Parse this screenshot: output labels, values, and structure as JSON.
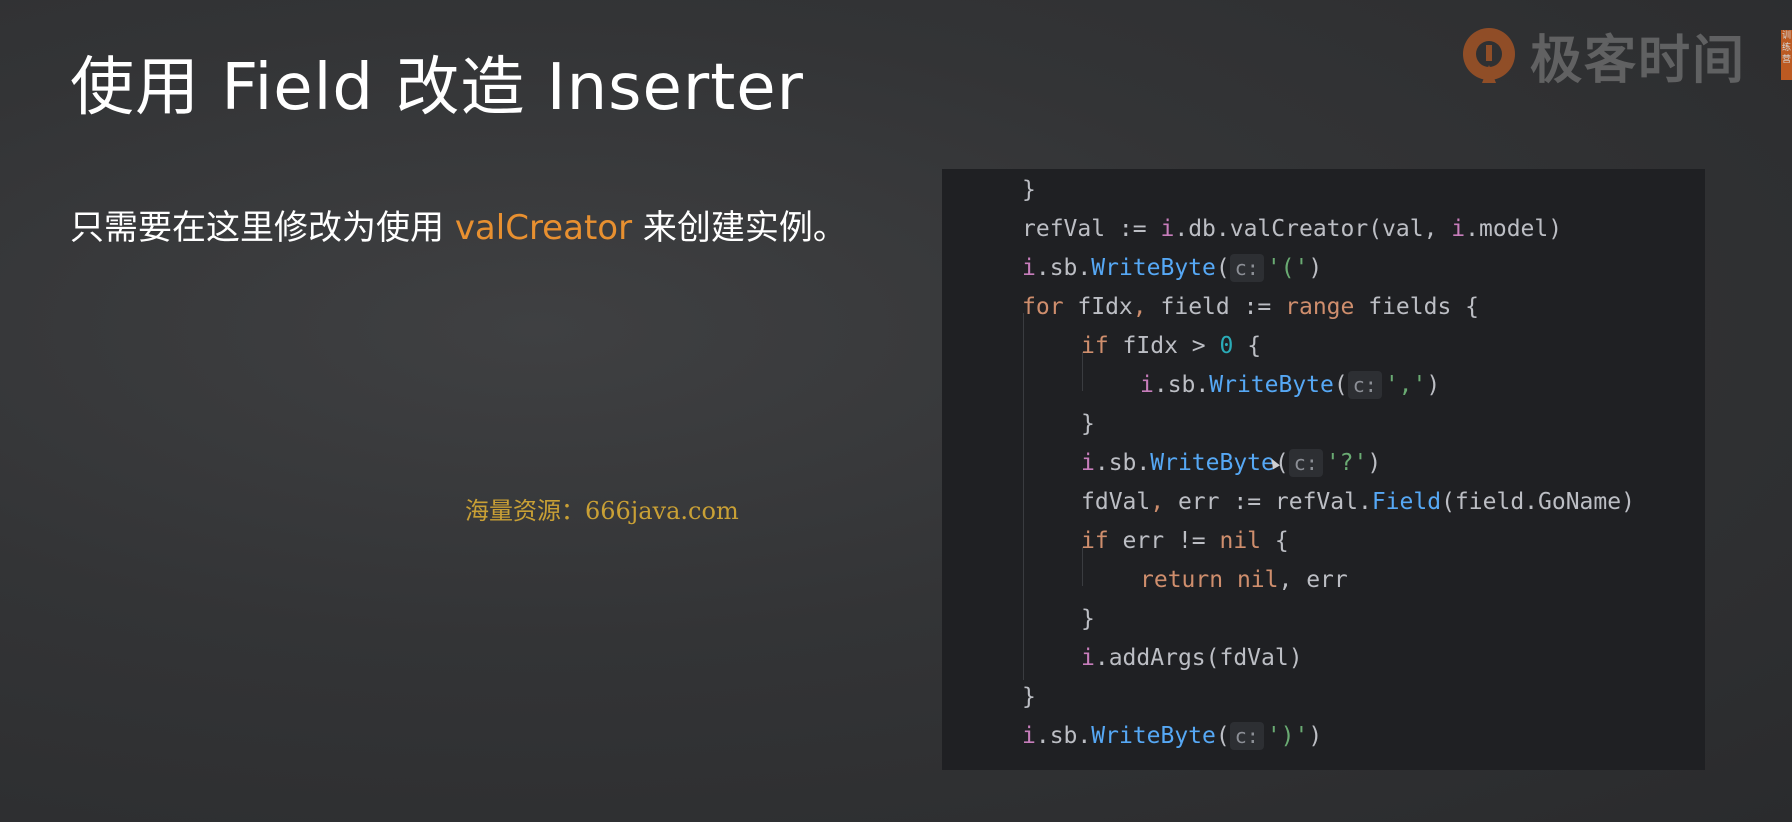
{
  "slide": {
    "title": "使用 Field 改造 Inserter",
    "description_prefix": "只需要在这里修改为使用 ",
    "description_highlight": "valCreator",
    "description_suffix": " 来创建实例。",
    "watermark": "海量资源：666java.com"
  },
  "logo": {
    "text": "极客时间",
    "badge": "训练营",
    "icon": "geektime-logo-icon",
    "color": "#e0661f"
  },
  "code": {
    "hint_label": "c:",
    "lines": [
      {
        "indent": 0,
        "tokens": [
          {
            "t": "}",
            "c": "plain"
          }
        ]
      },
      {
        "indent": 0,
        "tokens": [
          {
            "t": "refVal := ",
            "c": "plain"
          },
          {
            "t": "i",
            "c": "recv"
          },
          {
            "t": ".db.valCreator(val, ",
            "c": "plain"
          },
          {
            "t": "i",
            "c": "recv"
          },
          {
            "t": ".model)",
            "c": "plain"
          }
        ]
      },
      {
        "indent": 0,
        "tokens": [
          {
            "t": "i",
            "c": "recv"
          },
          {
            "t": ".sb.",
            "c": "plain"
          },
          {
            "t": "WriteByte",
            "c": "fn"
          },
          {
            "t": "(",
            "c": "plain"
          },
          {
            "hint": "c:"
          },
          {
            "t": "'('",
            "c": "str"
          },
          {
            "t": ")",
            "c": "plain"
          }
        ]
      },
      {
        "indent": 0,
        "tokens": [
          {
            "t": "for",
            "c": "kw"
          },
          {
            "t": " fIdx",
            "c": "plain"
          },
          {
            "t": ",",
            "c": "kw"
          },
          {
            "t": " field := ",
            "c": "plain"
          },
          {
            "t": "range",
            "c": "kw"
          },
          {
            "t": " fields {",
            "c": "plain"
          }
        ]
      },
      {
        "indent": 1,
        "tokens": [
          {
            "t": "if",
            "c": "kw"
          },
          {
            "t": " fIdx > ",
            "c": "plain"
          },
          {
            "t": "0",
            "c": "num"
          },
          {
            "t": " {",
            "c": "plain"
          }
        ]
      },
      {
        "indent": 2,
        "tokens": [
          {
            "t": "i",
            "c": "recv"
          },
          {
            "t": ".sb.",
            "c": "plain"
          },
          {
            "t": "WriteByte",
            "c": "fn"
          },
          {
            "t": "(",
            "c": "plain"
          },
          {
            "hint": "c:"
          },
          {
            "t": "','",
            "c": "str"
          },
          {
            "t": ")",
            "c": "plain"
          }
        ]
      },
      {
        "indent": 1,
        "tokens": [
          {
            "t": "}",
            "c": "plain"
          }
        ]
      },
      {
        "indent": 1,
        "tokens": [
          {
            "t": "i",
            "c": "recv"
          },
          {
            "t": ".sb.",
            "c": "plain"
          },
          {
            "t": "WriteByte",
            "c": "fn"
          },
          {
            "t": "(",
            "c": "plain"
          },
          {
            "hint": "c:"
          },
          {
            "t": "'?'",
            "c": "str"
          },
          {
            "t": ")",
            "c": "plain"
          }
        ]
      },
      {
        "indent": 1,
        "tokens": [
          {
            "t": "fdVal",
            "c": "plain"
          },
          {
            "t": ",",
            "c": "kw"
          },
          {
            "t": " err := refVal.",
            "c": "plain"
          },
          {
            "t": "Field",
            "c": "fn"
          },
          {
            "t": "(field.GoName)",
            "c": "plain"
          }
        ]
      },
      {
        "indent": 1,
        "tokens": [
          {
            "t": "if",
            "c": "kw"
          },
          {
            "t": " err != ",
            "c": "plain"
          },
          {
            "t": "nil",
            "c": "kw"
          },
          {
            "t": " {",
            "c": "plain"
          }
        ]
      },
      {
        "indent": 2,
        "tokens": [
          {
            "t": "return",
            "c": "kw"
          },
          {
            "t": " ",
            "c": "plain"
          },
          {
            "t": "nil",
            "c": "kw"
          },
          {
            "t": ", err",
            "c": "plain"
          }
        ]
      },
      {
        "indent": 1,
        "tokens": [
          {
            "t": "}",
            "c": "plain"
          }
        ]
      },
      {
        "indent": 1,
        "tokens": [
          {
            "t": "i",
            "c": "recv"
          },
          {
            "t": ".addArgs(fdVal)",
            "c": "plain"
          }
        ]
      },
      {
        "indent": 0,
        "tokens": [
          {
            "t": "}",
            "c": "plain"
          }
        ]
      },
      {
        "indent": 0,
        "tokens": [
          {
            "t": "i",
            "c": "recv"
          },
          {
            "t": ".sb.",
            "c": "plain"
          },
          {
            "t": "WriteByte",
            "c": "fn"
          },
          {
            "t": "(",
            "c": "plain"
          },
          {
            "hint": "c:"
          },
          {
            "t": "')'",
            "c": "str"
          },
          {
            "t": ")",
            "c": "plain"
          }
        ]
      }
    ]
  }
}
